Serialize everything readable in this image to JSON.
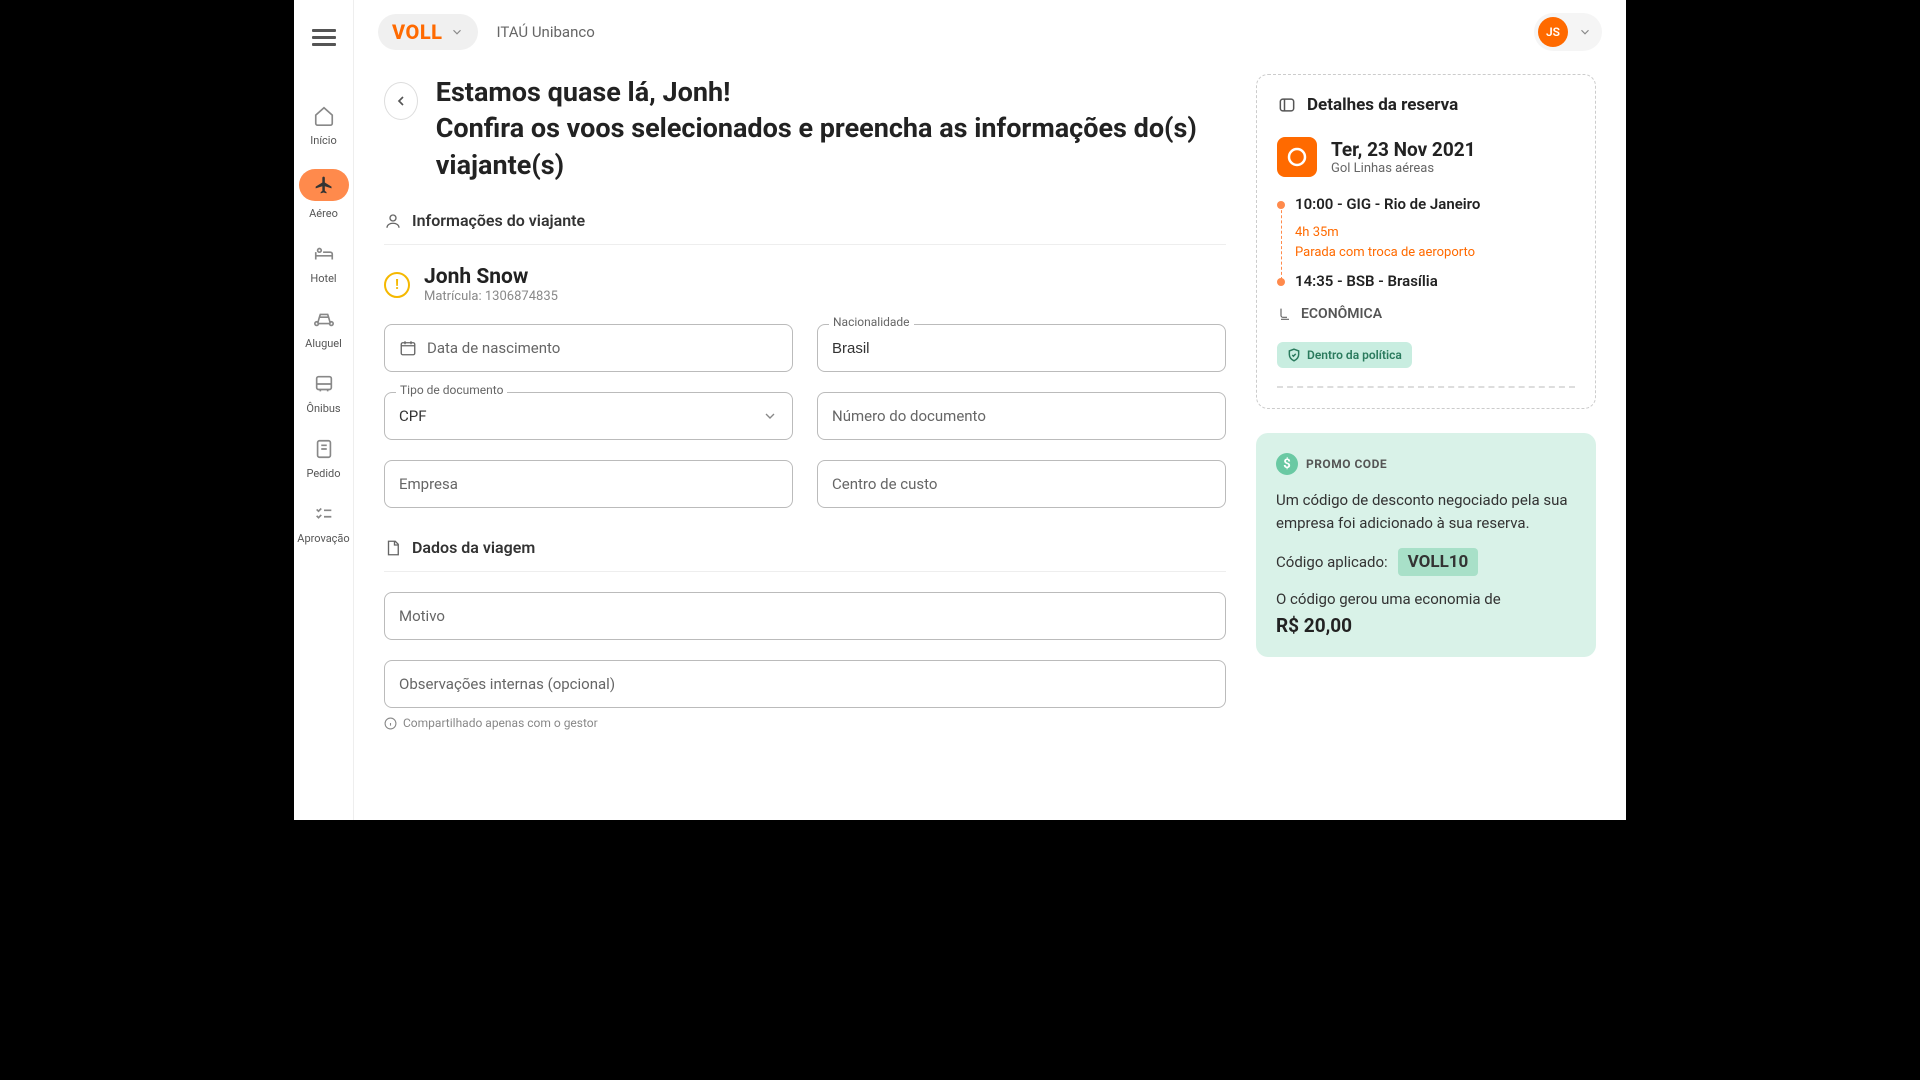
{
  "header": {
    "brand": "VOLL",
    "company": "ITAÚ Unibanco",
    "user_initials": "JS"
  },
  "sidebar": {
    "items": [
      {
        "label": "Início"
      },
      {
        "label": "Aéreo"
      },
      {
        "label": "Hotel"
      },
      {
        "label": "Aluguel"
      },
      {
        "label": "Ônibus"
      },
      {
        "label": "Pedido"
      },
      {
        "label": "Aprovação"
      }
    ]
  },
  "page": {
    "title_line1": "Estamos quase lá, Jonh!",
    "title_line2": "Confira os voos selecionados e preencha as informações do(s) viajante(s)"
  },
  "traveler": {
    "section_title": "Informações do viajante",
    "name": "Jonh Snow",
    "matricula_label": "Matrícula: 1306874835",
    "fields": {
      "dob_placeholder": "Data de nascimento",
      "nationality_label": "Nacionalidade",
      "nationality_value": "Brasil",
      "doc_type_label": "Tipo de documento",
      "doc_type_value": "CPF",
      "doc_number_placeholder": "Número do documento",
      "company_placeholder": "Empresa",
      "cost_center_placeholder": "Centro de custo"
    }
  },
  "trip": {
    "section_title": "Dados da viagem",
    "reason_placeholder": "Motivo",
    "notes_placeholder": "Observações internas (opcional)",
    "notes_hint": "Compartilhado apenas com o gestor"
  },
  "booking": {
    "title": "Detalhes da reserva",
    "date": "Ter, 23 Nov 2021",
    "airline": "Gol Linhas aéreas",
    "departure": "10:00 - GIG - Rio de Janeiro",
    "duration": "4h 35m",
    "stop_note": "Parada com troca de aeroporto",
    "arrival": "14:35 - BSB - Brasília",
    "class": "ECONÔMICA",
    "policy": "Dentro da política"
  },
  "promo": {
    "label": "PROMO CODE",
    "description": "Um código de desconto negociado pela sua empresa foi adicionado à sua reserva.",
    "applied_label": "Código aplicado:",
    "code": "VOLL10",
    "savings_label": "O código gerou uma economia de",
    "savings_value": "R$ 20,00"
  }
}
